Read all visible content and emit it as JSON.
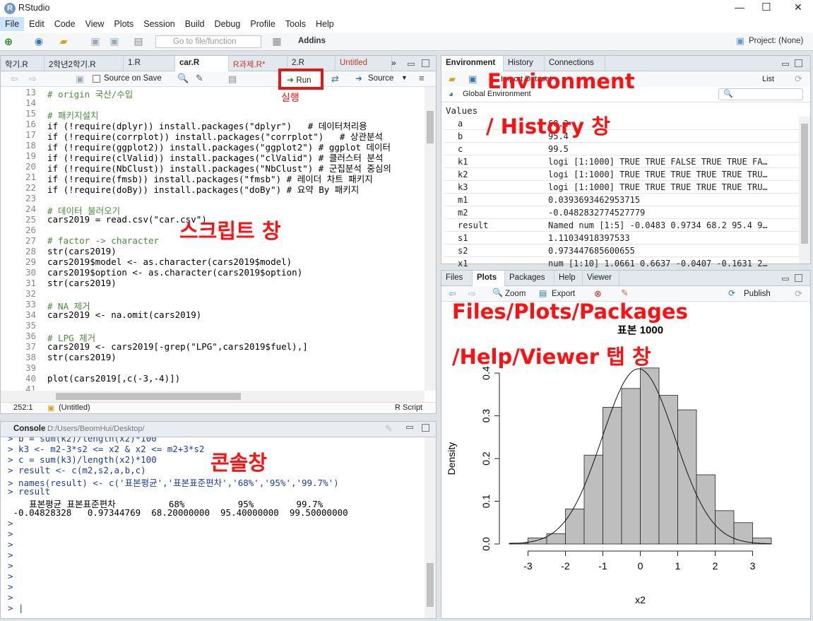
{
  "window": {
    "title": "RStudio",
    "icon_letter": "R",
    "min": "—",
    "max": "☐",
    "close": "✕"
  },
  "menu": [
    "File",
    "Edit",
    "Code",
    "View",
    "Plots",
    "Session",
    "Build",
    "Debug",
    "Profile",
    "Tools",
    "Help"
  ],
  "toolbar": {
    "goto_placeholder": "Go to file/function",
    "addins": "Addins",
    "project": "Project: (None)"
  },
  "source": {
    "tabs": [
      "학기.R",
      "2학년2학기.R",
      "1.R",
      "car.R",
      "R과제.R*",
      "2.R",
      "Untitled"
    ],
    "source_on_save": "Source on Save",
    "run": "Run",
    "source_btn": "Source",
    "lines": [
      {
        "n": "13",
        "t": "# origin 국산/수입",
        "c": "#4a8a3a"
      },
      {
        "n": "14",
        "t": "",
        "c": "#000"
      },
      {
        "n": "15",
        "t": "# 패키지설치",
        "c": "#4a8a3a"
      },
      {
        "n": "16",
        "t": "if (!require(dplyr)) install.packages(\"dplyr\")   # 데이터처리용",
        "c": "#000"
      },
      {
        "n": "17",
        "t": "if (!require(corrplot)) install.packages(\"corrplot\")   # 상관분석",
        "c": "#000"
      },
      {
        "n": "18",
        "t": "if (!require(ggplot2)) install.packages(\"ggplot2\") # ggplot 데이터",
        "c": "#000"
      },
      {
        "n": "19",
        "t": "if (!require(clValid)) install.packages(\"clValid\") # 클러스터 분석",
        "c": "#000"
      },
      {
        "n": "20",
        "t": "if (!require(NbClust)) install.packages(\"NbClust\") # 군집분석 중심의",
        "c": "#000"
      },
      {
        "n": "21",
        "t": "if (!require(fmsb)) install.packages(\"fmsb\") # 레이더 차트 패키지",
        "c": "#000"
      },
      {
        "n": "22",
        "t": "if (!require(doBy)) install.packages(\"doBy\") # 요약 By 패키지",
        "c": "#000"
      },
      {
        "n": "23",
        "t": "",
        "c": "#000"
      },
      {
        "n": "24",
        "t": "# 데이터 불러오기",
        "c": "#4a8a3a"
      },
      {
        "n": "25",
        "t": "cars2019 = read.csv(\"car.csv\")",
        "c": "#000"
      },
      {
        "n": "26",
        "t": "",
        "c": "#000"
      },
      {
        "n": "27",
        "t": "# factor -> character",
        "c": "#4a8a3a"
      },
      {
        "n": "28",
        "t": "str(cars2019)",
        "c": "#000"
      },
      {
        "n": "29",
        "t": "cars2019$model <- as.character(cars2019$model)",
        "c": "#000"
      },
      {
        "n": "30",
        "t": "cars2019$option <- as.character(cars2019$option)",
        "c": "#000"
      },
      {
        "n": "31",
        "t": "str(cars2019)",
        "c": "#000"
      },
      {
        "n": "32",
        "t": "",
        "c": "#000"
      },
      {
        "n": "33",
        "t": "# NA 제거",
        "c": "#4a8a3a"
      },
      {
        "n": "34",
        "t": "cars2019 <- na.omit(cars2019)",
        "c": "#000"
      },
      {
        "n": "35",
        "t": "",
        "c": "#000"
      },
      {
        "n": "36",
        "t": "# LPG 제거",
        "c": "#4a8a3a"
      },
      {
        "n": "37",
        "t": "cars2019 <- cars2019[-grep(\"LPG\",cars2019$fuel),]",
        "c": "#000"
      },
      {
        "n": "38",
        "t": "str(cars2019)",
        "c": "#000"
      },
      {
        "n": "39",
        "t": "",
        "c": "#000"
      },
      {
        "n": "40",
        "t": "plot(cars2019[,c(-3,-4)])",
        "c": "#000"
      },
      {
        "n": "41",
        "t": "",
        "c": "#000"
      },
      {
        "n": "42",
        "t": "",
        "c": "#000"
      }
    ],
    "status_pos": "252:1",
    "status_ctx": "(Untitled)",
    "status_type": "R Script"
  },
  "console": {
    "title": "Console",
    "path": "D:/Users/BeomHui/Desktop/",
    "lines": [
      {
        "t": "> b = sum(k2)/length(x2)*100",
        "c": "#1a3ab5"
      },
      {
        "t": "> k3 <- m2-3*s2 <= x2 & x2 <= m2+3*s2",
        "c": "#1a3ab5"
      },
      {
        "t": "> c = sum(k3)/length(x2)*100",
        "c": "#1a3ab5"
      },
      {
        "t": "> result <- c(m2,s2,a,b,c)",
        "c": "#1a3ab5"
      },
      {
        "t": "> names(result) <- c('표본평균','표본표준편차','68%','95%','99.7%')",
        "c": "#1a3ab5"
      },
      {
        "t": "> result",
        "c": "#1a3ab5"
      },
      {
        "t": "    표본평균 표본표준편차          68%          95%        99.7%",
        "c": "#000"
      },
      {
        "t": " -0.04828328   0.97344769  68.20000000  95.40000000  99.50000000",
        "c": "#000"
      },
      {
        "t": ">",
        "c": "#1a3ab5"
      },
      {
        "t": ">",
        "c": "#1a3ab5"
      },
      {
        "t": ">",
        "c": "#1a3ab5"
      },
      {
        "t": ">",
        "c": "#1a3ab5"
      },
      {
        "t": ">",
        "c": "#1a3ab5"
      },
      {
        "t": ">",
        "c": "#1a3ab5"
      },
      {
        "t": ">",
        "c": "#1a3ab5"
      },
      {
        "t": ">",
        "c": "#1a3ab5"
      },
      {
        "t": "> |",
        "c": "#1a3ab5"
      }
    ]
  },
  "env": {
    "tabs": [
      "Environment",
      "History",
      "Connections"
    ],
    "import": "Import Dataset",
    "list": "List",
    "global": "Global Environment",
    "values_header": "Values",
    "rows": [
      [
        "a",
        "68.2"
      ],
      [
        "b",
        "95.4"
      ],
      [
        "c",
        "99.5"
      ],
      [
        "k1",
        "logi [1:1000] TRUE TRUE FALSE TRUE TRUE FA…"
      ],
      [
        "k2",
        "logi [1:1000] TRUE TRUE TRUE TRUE TRUE TRU…"
      ],
      [
        "k3",
        "logi [1:1000] TRUE TRUE TRUE TRUE TRUE TRU…"
      ],
      [
        "m1",
        "0.0393693462953715"
      ],
      [
        "m2",
        "-0.0482832774527779"
      ],
      [
        "result",
        "Named num [1:5] -0.0483 0.9734 68.2 95.4 9…"
      ],
      [
        "s1",
        "1.11034918397533"
      ],
      [
        "s2",
        "0.973447685600655"
      ],
      [
        "x1",
        "num [1:10] 1.0661 0.6637 -0.0407 -0.1631 2…"
      ]
    ]
  },
  "files": {
    "tabs": [
      "Files",
      "Plots",
      "Packages",
      "Help",
      "Viewer"
    ],
    "zoom": "Zoom",
    "export": "Export",
    "publish": "Publish"
  },
  "annotations": {
    "run": "실행",
    "env1": "Environment",
    "env2": "/ History 창",
    "script": "스크립트 창",
    "console": "콘솔창",
    "files1": "Files/Plots/Packages",
    "files2": "/Help/Viewer 탭 창"
  },
  "chart_data": {
    "type": "histogram",
    "title": "표본 1000",
    "xlabel": "x2",
    "ylabel": "Density",
    "bin_edges": [
      -3.5,
      -3,
      -2.5,
      -2,
      -1.5,
      -1,
      -0.5,
      0,
      0.5,
      1,
      1.5,
      2,
      2.5,
      3,
      3.5
    ],
    "densities": [
      0.002,
      0.014,
      0.024,
      0.082,
      0.208,
      0.32,
      0.364,
      0.412,
      0.348,
      0.314,
      0.162,
      0.078,
      0.05,
      0.014,
      0.006
    ],
    "overlay": "normal density curve",
    "xticks": [
      -3,
      -2,
      -1,
      0,
      1,
      2,
      3
    ],
    "yticks": [
      0.0,
      0.1,
      0.2,
      0.3,
      0.4
    ],
    "xlim": [
      -3.5,
      3.5
    ],
    "ylim": [
      0,
      0.42
    ]
  },
  "colors": {
    "annotation": "#ff1010",
    "bar_fill": "#bebebe",
    "accent": "#1f63b0"
  }
}
